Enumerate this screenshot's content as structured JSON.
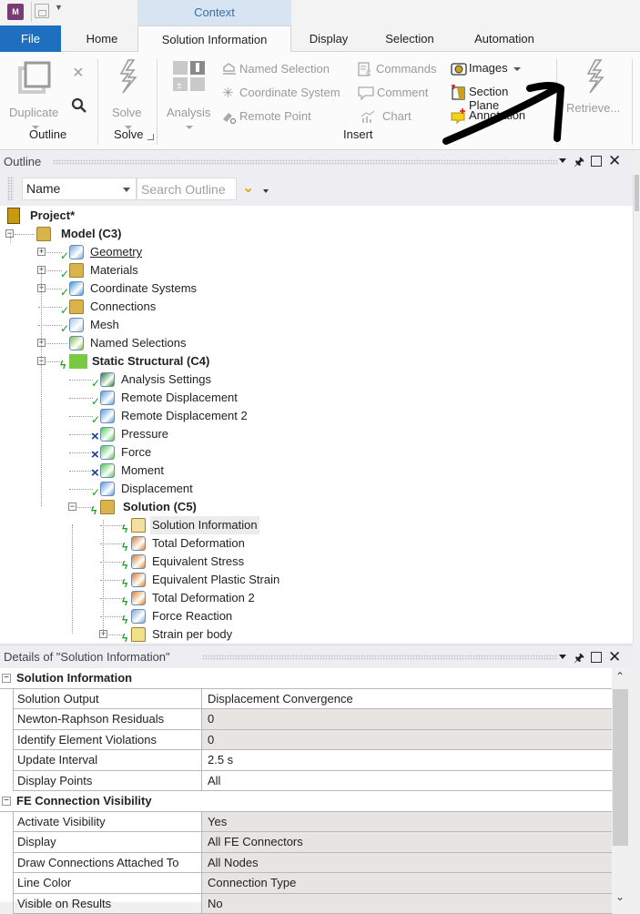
{
  "titlebar": {
    "app_icon": "M",
    "context_label": "Context"
  },
  "tabs": [
    {
      "label": "File"
    },
    {
      "label": "Home"
    },
    {
      "label": "Solution Information",
      "active": true
    },
    {
      "label": "Display"
    },
    {
      "label": "Selection"
    },
    {
      "label": "Automation"
    }
  ],
  "ribbon": {
    "outline_group": {
      "label": "Outline",
      "duplicate": "Duplicate"
    },
    "solve_group": {
      "label": "Solve",
      "solve": "Solve"
    },
    "insert_group": {
      "label": "Insert",
      "analysis": "Analysis",
      "named_selection": "Named Selection",
      "coordinate_system": "Coordinate System",
      "remote_point": "Remote Point",
      "commands": "Commands",
      "comment": "Comment",
      "chart": "Chart",
      "images": "Images",
      "section_plane": "Section Plane",
      "annotation": "Annotation"
    },
    "retrieve": "Retrieve..."
  },
  "outline": {
    "title": "Outline",
    "filter_select": "Name",
    "search_placeholder": "Search Outline",
    "tree": [
      {
        "label": "Project*",
        "bold": true,
        "icon": "project-icon"
      },
      {
        "label": "Model (C3)",
        "bold": true,
        "icon": "model-icon"
      },
      {
        "label": "Geometry",
        "status": "ok",
        "icon": "geometry-icon",
        "underline": true
      },
      {
        "label": "Materials",
        "status": "ok",
        "icon": "materials-icon"
      },
      {
        "label": "Coordinate Systems",
        "status": "ok",
        "icon": "coordinate-systems-icon"
      },
      {
        "label": "Connections",
        "status": "ok",
        "icon": "connections-icon"
      },
      {
        "label": "Mesh",
        "status": "ok",
        "icon": "mesh-icon"
      },
      {
        "label": "Named Selections",
        "icon": "named-selections-icon"
      },
      {
        "label": "Static Structural (C4)",
        "bold": true,
        "status": "solve",
        "icon": "static-structural-icon"
      },
      {
        "label": "Analysis Settings",
        "status": "ok",
        "icon": "analysis-settings-icon"
      },
      {
        "label": "Remote Displacement",
        "status": "ok",
        "icon": "remote-displacement-icon"
      },
      {
        "label": "Remote Displacement 2",
        "status": "ok",
        "icon": "remote-displacement-icon"
      },
      {
        "label": "Pressure",
        "status": "suppressed",
        "icon": "pressure-icon"
      },
      {
        "label": "Force",
        "status": "suppressed",
        "icon": "force-icon"
      },
      {
        "label": "Moment",
        "status": "suppressed",
        "icon": "moment-icon"
      },
      {
        "label": "Displacement",
        "status": "ok",
        "icon": "displacement-icon"
      },
      {
        "label": "Solution (C5)",
        "bold": true,
        "status": "solve",
        "icon": "solution-icon"
      },
      {
        "label": "Solution Information",
        "status": "solve",
        "icon": "solution-information-icon",
        "selected": true
      },
      {
        "label": "Total Deformation",
        "status": "solve",
        "icon": "result-icon"
      },
      {
        "label": "Equivalent Stress",
        "status": "solve",
        "icon": "result-icon"
      },
      {
        "label": "Equivalent Plastic Strain",
        "status": "solve",
        "icon": "result-icon"
      },
      {
        "label": "Total Deformation 2",
        "status": "solve",
        "icon": "result-icon"
      },
      {
        "label": "Force Reaction",
        "status": "solve",
        "icon": "probe-icon"
      },
      {
        "label": "Strain per body",
        "status": "solve",
        "icon": "folder-icon"
      }
    ]
  },
  "details": {
    "title": "Details of \"Solution Information\"",
    "groups": [
      {
        "label": "Solution Information",
        "rows": [
          {
            "key": "Solution Output",
            "value": "Displacement Convergence",
            "editable": true
          },
          {
            "key": "Newton-Raphson Residuals",
            "value": "0"
          },
          {
            "key": "Identify Element Violations",
            "value": "0"
          },
          {
            "key": "Update Interval",
            "value": "2.5 s",
            "editable": true
          },
          {
            "key": "Display Points",
            "value": "All",
            "editable": true
          }
        ]
      },
      {
        "label": "FE Connection Visibility",
        "rows": [
          {
            "key": "Activate Visibility",
            "value": "Yes"
          },
          {
            "key": "Display",
            "value": "All FE Connectors"
          },
          {
            "key": "Draw Connections Attached To",
            "value": "All Nodes"
          },
          {
            "key": "Line Color",
            "value": "Connection Type"
          },
          {
            "key": "Visible on Results",
            "value": "No"
          }
        ]
      }
    ]
  },
  "colors": {
    "file_tab": "#1e6fc0",
    "context_bg": "#d7e4f2",
    "ok_check": "#1e9a1e",
    "suppressed_x": "#1f3c9a"
  }
}
